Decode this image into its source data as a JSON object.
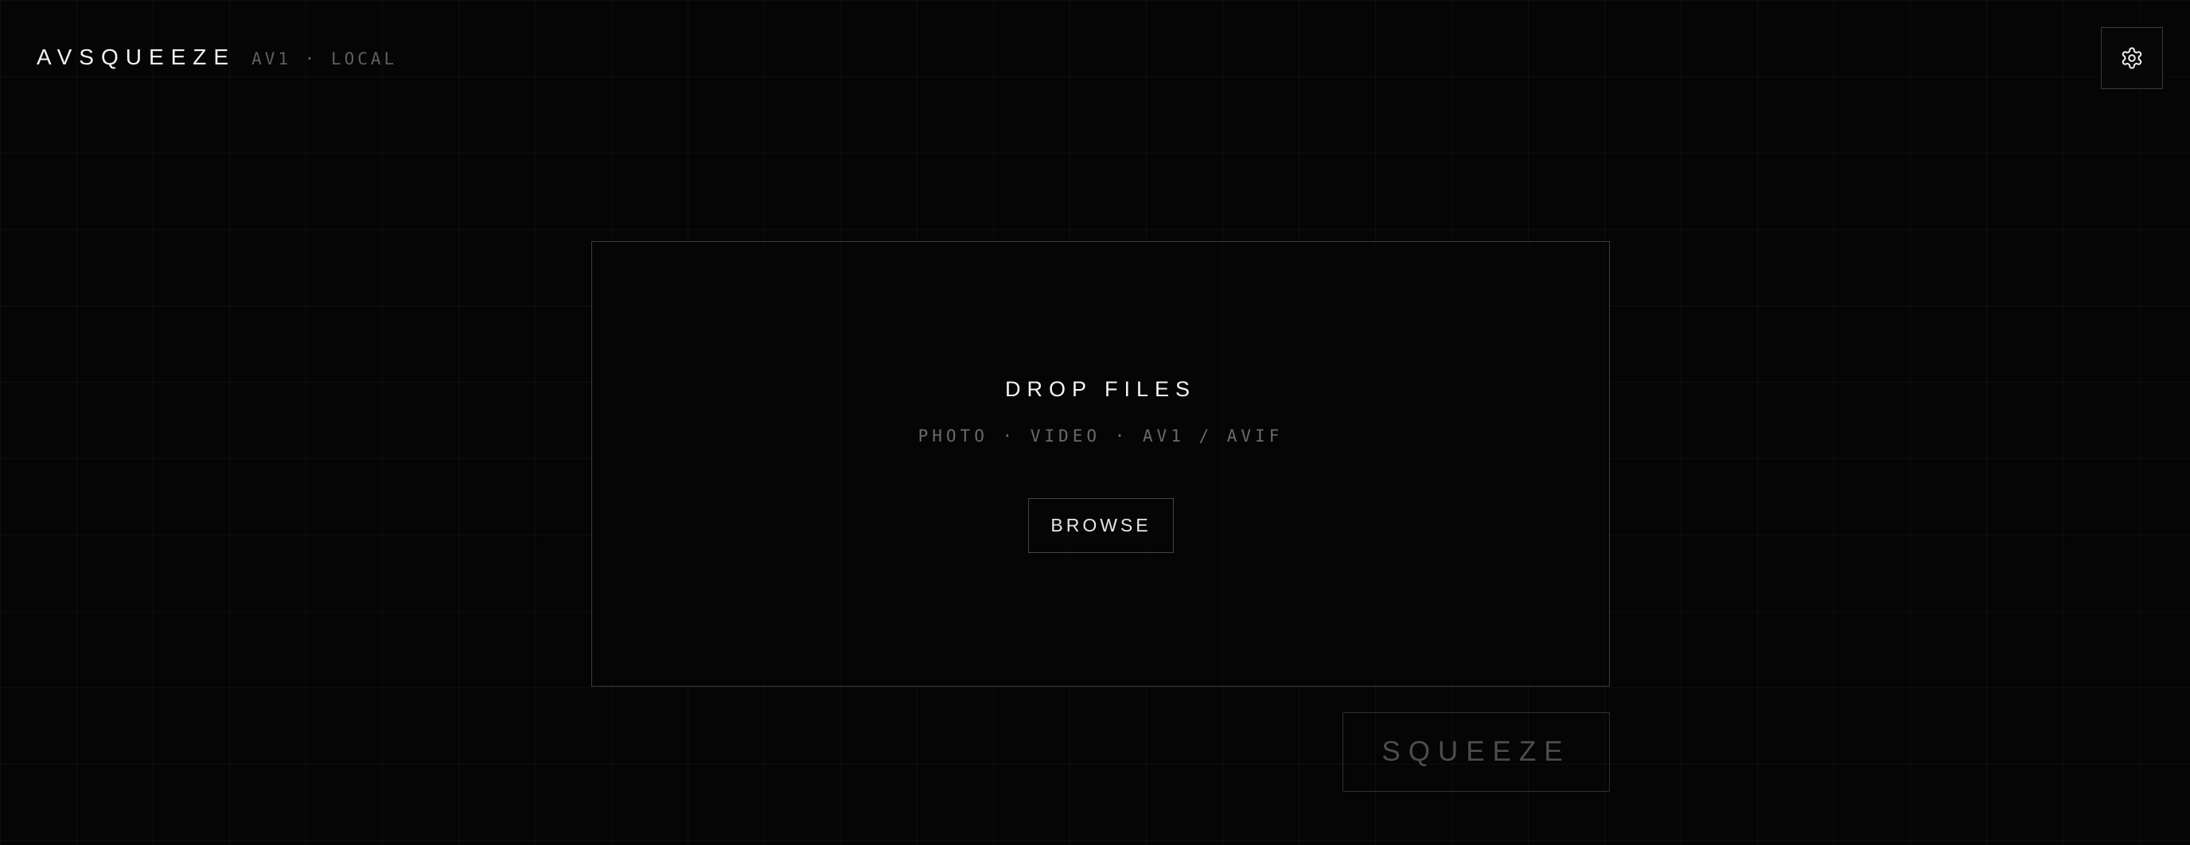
{
  "header": {
    "brand": "AVSQUEEZE",
    "tagline": "AV1 · LOCAL",
    "settings_icon": "gear-icon"
  },
  "dropzone": {
    "title": "DROP FILES",
    "subtitle": "PHOTO · VIDEO · AV1 / AVIF",
    "browse_label": "BROWSE"
  },
  "actions": {
    "squeeze_label": "SQUEEZE",
    "squeeze_state": "disabled"
  },
  "colors": {
    "background": "#050505",
    "text": "#f2f2f2",
    "muted": "#5f5f5f",
    "border": "#3d3d3d"
  }
}
